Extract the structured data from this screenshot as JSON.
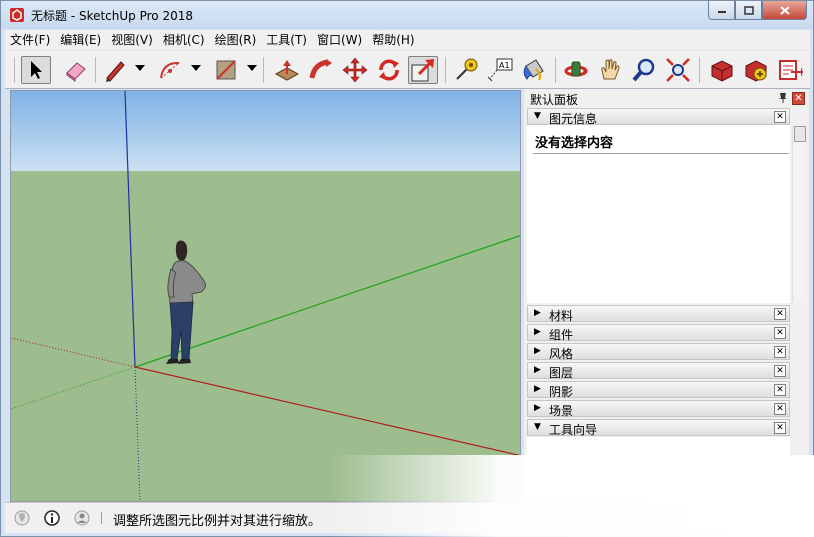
{
  "window": {
    "title": "无标题 - SketchUp Pro 2018",
    "controls": [
      "minimize",
      "maximize",
      "close"
    ]
  },
  "menu": [
    "文件(F)",
    "编辑(E)",
    "视图(V)",
    "相机(C)",
    "绘图(R)",
    "工具(T)",
    "窗口(W)",
    "帮助(H)"
  ],
  "toolbar": {
    "tools": [
      {
        "name": "select-tool",
        "icon": "arrow-cursor-icon",
        "selected": true
      },
      {
        "name": "eraser-tool",
        "icon": "eraser-icon"
      },
      {
        "name": "line-tool",
        "icon": "pencil-icon",
        "dropdown": true
      },
      {
        "name": "arc-tool",
        "icon": "arc-icon",
        "dropdown": true
      },
      {
        "name": "shape-tool",
        "icon": "rectangle-icon",
        "dropdown": true
      },
      {
        "name": "push-pull-tool",
        "icon": "push-pull-icon"
      },
      {
        "name": "follow-me-tool",
        "icon": "follow-me-icon"
      },
      {
        "name": "move-tool",
        "icon": "move-icon"
      },
      {
        "name": "rotate-tool",
        "icon": "rotate-icon"
      },
      {
        "name": "scale-tool",
        "icon": "scale-icon",
        "selected": true
      },
      {
        "name": "tape-measure-tool",
        "icon": "tape-measure-icon"
      },
      {
        "name": "text-tool",
        "icon": "text-label-icon",
        "label": "A1"
      },
      {
        "name": "paint-bucket-tool",
        "icon": "paint-bucket-icon"
      },
      {
        "name": "orbit-tool",
        "icon": "orbit-icon"
      },
      {
        "name": "pan-tool",
        "icon": "hand-icon"
      },
      {
        "name": "zoom-tool",
        "icon": "magnifier-icon"
      },
      {
        "name": "zoom-extents-tool",
        "icon": "zoom-extents-icon"
      },
      {
        "name": "warehouse-tool",
        "icon": "3d-warehouse-icon"
      },
      {
        "name": "extension-warehouse-tool",
        "icon": "extension-warehouse-icon"
      },
      {
        "name": "layout-tool",
        "icon": "send-to-layout-icon"
      }
    ]
  },
  "tray": {
    "title": "默认面板",
    "entity_info": {
      "label": "图元信息",
      "expanded": true,
      "content": "没有选择内容"
    },
    "panels": [
      {
        "label": "材料",
        "expanded": false
      },
      {
        "label": "组件",
        "expanded": false
      },
      {
        "label": "风格",
        "expanded": false
      },
      {
        "label": "图层",
        "expanded": false
      },
      {
        "label": "阴影",
        "expanded": false
      },
      {
        "label": "场景",
        "expanded": false
      },
      {
        "label": "工具向导",
        "expanded": true
      }
    ]
  },
  "status": {
    "text": "调整所选图元比例并对其进行缩放。",
    "icons": [
      "geo-location-icon",
      "info-icon",
      "user-icon"
    ]
  },
  "colors": {
    "sky": "#a9cbee",
    "ground": "#9dbd8e",
    "red_axis": "#b01e1e",
    "green_axis": "#1fa21f",
    "blue_axis": "#2030a0"
  }
}
